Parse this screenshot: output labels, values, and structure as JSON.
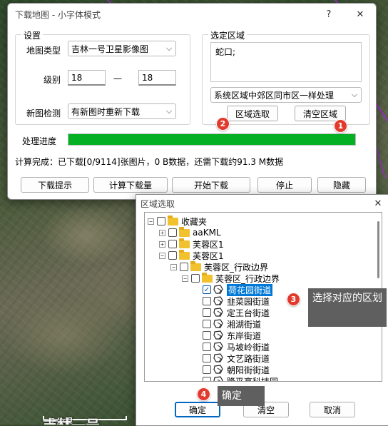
{
  "map": {
    "scale_label": "2公里",
    "map_name": "吉林一号"
  },
  "main_window": {
    "title": "下载地图 - 小字体模式",
    "help_glyph": "?",
    "close_glyph": "✕",
    "settings_group": "设置",
    "map_type_label": "地图类型",
    "map_type_value": "吉林一号卫星影像图",
    "level_label": "级别",
    "level_from": "18",
    "level_dash": "—",
    "level_to": "18",
    "new_map_label": "新图检测",
    "new_map_value": "有新图时重新下载",
    "region_group": "选定区域",
    "region_text": "蛇口;",
    "region_mode_value": "系统区域中郊区同市区一样处理",
    "region_select_button": "区域选取",
    "clear_region_button": "清空区域",
    "progress_label": "处理进度",
    "progress_fraction": 1.0,
    "status_text": "计算完成：已下载[0/9114]张图片，0 B数据，还需下载约91.3 M数据",
    "buttons": [
      "下载提示",
      "计算下载量",
      "开始下载",
      "停止",
      "隐藏"
    ]
  },
  "dialog": {
    "title": "区域选取",
    "close_glyph": "✕",
    "tree": [
      {
        "label": "收藏夹",
        "icon": "folder-icon",
        "checked": false,
        "expander": "−"
      },
      {
        "label": "aaKML",
        "icon": "folder-icon",
        "checked": false,
        "expander": "+"
      },
      {
        "label": "芙蓉区1",
        "icon": "folder-icon",
        "checked": false,
        "expander": "+"
      },
      {
        "label": "芙蓉区1",
        "icon": "folder-icon",
        "checked": false,
        "expander": "−"
      },
      {
        "label": "芙蓉区_行政边界",
        "icon": "folder-icon",
        "checked": false,
        "expander": "−"
      },
      {
        "label": "芙蓉区_行政边界",
        "icon": "folder-icon",
        "checked": false,
        "expander": "−"
      },
      {
        "label": "荷花园街道",
        "icon": "polygon-icon",
        "checked": true,
        "selected": true
      },
      {
        "label": "韭菜园街道",
        "icon": "polygon-icon",
        "checked": false
      },
      {
        "label": "定王台街道",
        "icon": "polygon-icon",
        "checked": false
      },
      {
        "label": "湘湖街道",
        "icon": "polygon-icon",
        "checked": false
      },
      {
        "label": "东岸街道",
        "icon": "polygon-icon",
        "checked": false
      },
      {
        "label": "马坡岭街道",
        "icon": "polygon-icon",
        "checked": false
      },
      {
        "label": "文艺路街道",
        "icon": "polygon-icon",
        "checked": false
      },
      {
        "label": "朝阳街街道",
        "icon": "polygon-icon",
        "checked": false
      },
      {
        "label": "隆平高科技园",
        "icon": "polygon-icon",
        "checked": false
      }
    ],
    "ok_button": "确定",
    "clear_button": "清空",
    "cancel_button": "取消"
  },
  "annotations": {
    "badge_1": "1",
    "badge_2": "2",
    "badge_3": "3",
    "badge_4": "4",
    "callout_3": "选择对应的区划",
    "callout_4": "确定",
    "badge_color": "#e23b2e"
  }
}
